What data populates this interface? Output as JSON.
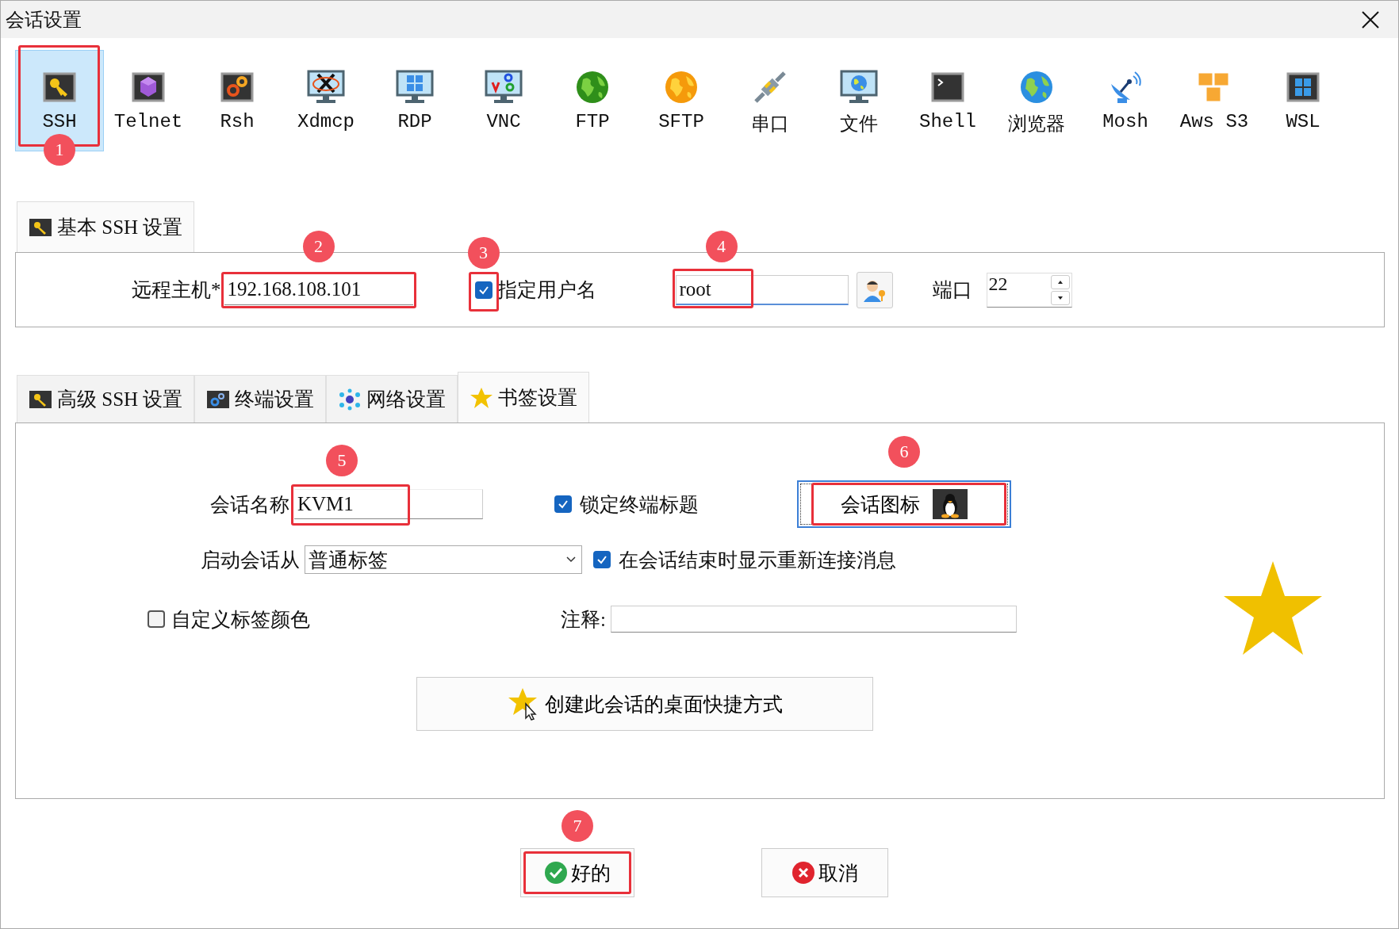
{
  "window": {
    "title": "会话设置"
  },
  "session_types": [
    {
      "label": "SSH",
      "selected": true,
      "annotation": "1"
    },
    {
      "label": "Telnet",
      "selected": false
    },
    {
      "label": "Rsh",
      "selected": false
    },
    {
      "label": "Xdmcp",
      "selected": false
    },
    {
      "label": "RDP",
      "selected": false
    },
    {
      "label": "VNC",
      "selected": false
    },
    {
      "label": "FTP",
      "selected": false
    },
    {
      "label": "SFTP",
      "selected": false
    },
    {
      "label": "串口",
      "selected": false
    },
    {
      "label": "文件",
      "selected": false
    },
    {
      "label": "Shell",
      "selected": false
    },
    {
      "label": "浏览器",
      "selected": false
    },
    {
      "label": "Mosh",
      "selected": false
    },
    {
      "label": "Aws S3",
      "selected": false
    },
    {
      "label": "WSL",
      "selected": false
    }
  ],
  "basic_tabs": [
    {
      "label": "基本 SSH 设置",
      "selected": true
    }
  ],
  "basic": {
    "host": {
      "label": "远程主机*",
      "value": "192.168.108.101",
      "annotation": "2"
    },
    "specify_user": {
      "label": "指定用户名",
      "checked": true,
      "annotation": "3"
    },
    "username": {
      "value": "root",
      "annotation": "4"
    },
    "port": {
      "label": "端口",
      "value": "22"
    }
  },
  "settings_tabs": [
    {
      "label": "高级 SSH 设置",
      "selected": false
    },
    {
      "label": "终端设置",
      "selected": false
    },
    {
      "label": "网络设置",
      "selected": false
    },
    {
      "label": "书签设置",
      "selected": true
    }
  ],
  "bookmark": {
    "session_name": {
      "label": "会话名称",
      "value": "KVM1",
      "annotation": "5"
    },
    "lock_title": {
      "label": "锁定终端标题",
      "checked": true
    },
    "session_icon": {
      "label": "会话图标",
      "annotation": "6"
    },
    "start_from": {
      "label": "启动会话从",
      "value": "普通标签"
    },
    "reconnect": {
      "label": "在会话结束时显示重新连接消息",
      "checked": true
    },
    "custom_color": {
      "label": "自定义标签颜色",
      "checked": false
    },
    "comment": {
      "label": "注释:"
    },
    "shortcut": {
      "label": "创建此会话的桌面快捷方式"
    }
  },
  "buttons": [
    {
      "label": "好的",
      "kind": "ok",
      "annotation": "7"
    },
    {
      "label": "取消",
      "kind": "cancel"
    }
  ]
}
